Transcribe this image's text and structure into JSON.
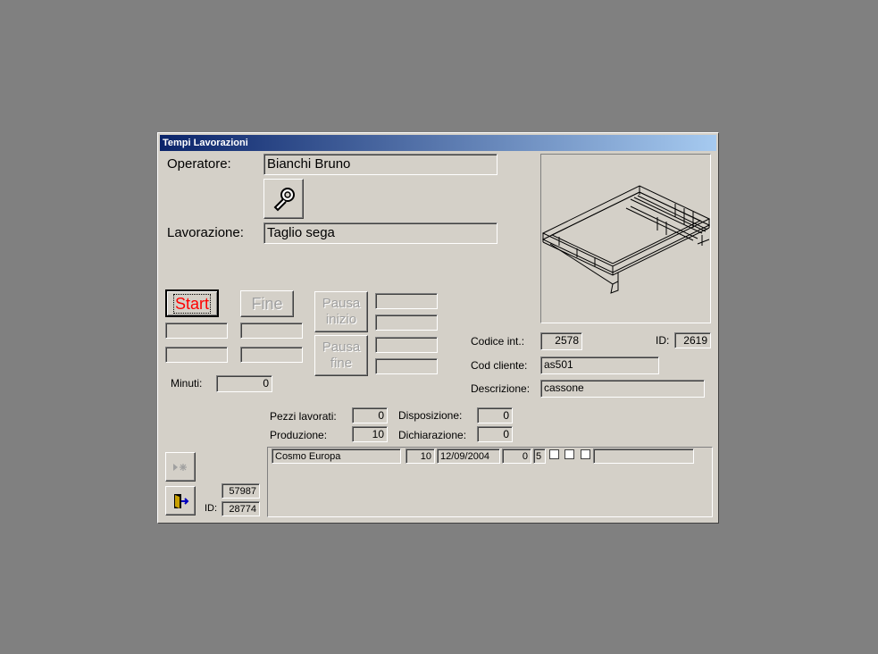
{
  "window": {
    "title": "Tempi Lavorazioni"
  },
  "operatore": {
    "label": "Operatore:",
    "value": "Bianchi Bruno"
  },
  "lavorazione": {
    "label": "Lavorazione:",
    "value": "Taglio sega"
  },
  "icons": {
    "tool": "wrench-icon",
    "new_record": "new-record-icon",
    "exit": "exit-door-icon"
  },
  "buttons": {
    "start": "Start",
    "fine": "Fine",
    "pausa_inizio": [
      "Pausa",
      "inizio"
    ],
    "pausa_fine": [
      "Pausa",
      "fine"
    ]
  },
  "minuti": {
    "label": "Minuti:",
    "value": "0"
  },
  "codice_int": {
    "label": "Codice  int.:",
    "value": "2578"
  },
  "id_top": {
    "label": "ID:",
    "value": "2619"
  },
  "cod_cliente": {
    "label": "Cod cliente:",
    "value": "as501"
  },
  "descrizione": {
    "label": "Descrizione:",
    "value": "cassone"
  },
  "pezzi_lavorati": {
    "label": "Pezzi lavorati:",
    "value": "0"
  },
  "produzione": {
    "label": "Produzione:",
    "value": "10"
  },
  "disposizione": {
    "label": "Disposizione:",
    "value": "0"
  },
  "dichiarazione": {
    "label": "Dichiarazione:",
    "value": "0"
  },
  "bottom": {
    "number": "57987",
    "id_label": "ID:",
    "id_value": "28774"
  },
  "row": {
    "cliente": "Cosmo Europa",
    "qty": "10",
    "date": "12/09/2004",
    "v1": "0",
    "v2": "5"
  },
  "colors": {
    "face": "#d4d0c8",
    "title_start": "#0a246a",
    "title_end": "#a6caf0",
    "start_text": "#ff0000"
  }
}
